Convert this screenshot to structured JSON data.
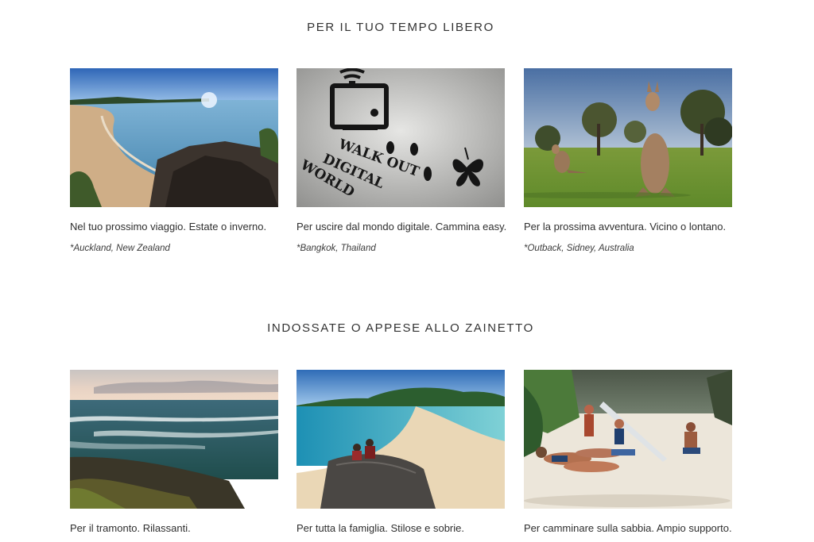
{
  "sections": [
    {
      "title": "PER IL TUO TEMPO LIBERO",
      "cards": [
        {
          "photo": "auckland-beach-photo",
          "caption": "Nel tuo prossimo viaggio. Estate o inverno.",
          "location": "*Auckland, New Zealand"
        },
        {
          "photo": "bangkok-stencil-photo",
          "caption": "Per uscire dal mondo digitale. Cammina easy.",
          "location": "*Bangkok, Thailand"
        },
        {
          "photo": "outback-kangaroo-photo",
          "caption": "Per la prossima avventura. Vicino o lontano.",
          "location": "*Outback, Sidney, Australia"
        }
      ]
    },
    {
      "title": "INDOSSATE O APPESE ALLO ZAINETTO",
      "cards": [
        {
          "photo": "sunset-coast-photo",
          "caption": "Per il tramonto. Rilassanti."
        },
        {
          "photo": "family-beach-photo",
          "caption": "Per tutta la famiglia. Stilose e sobrie."
        },
        {
          "photo": "sand-walk-photo",
          "caption": "Per camminare sulla sabbia. Ampio supporto."
        }
      ]
    }
  ],
  "stencil_text": [
    "WALK OUT",
    "DIGITAL",
    "WORLD"
  ]
}
